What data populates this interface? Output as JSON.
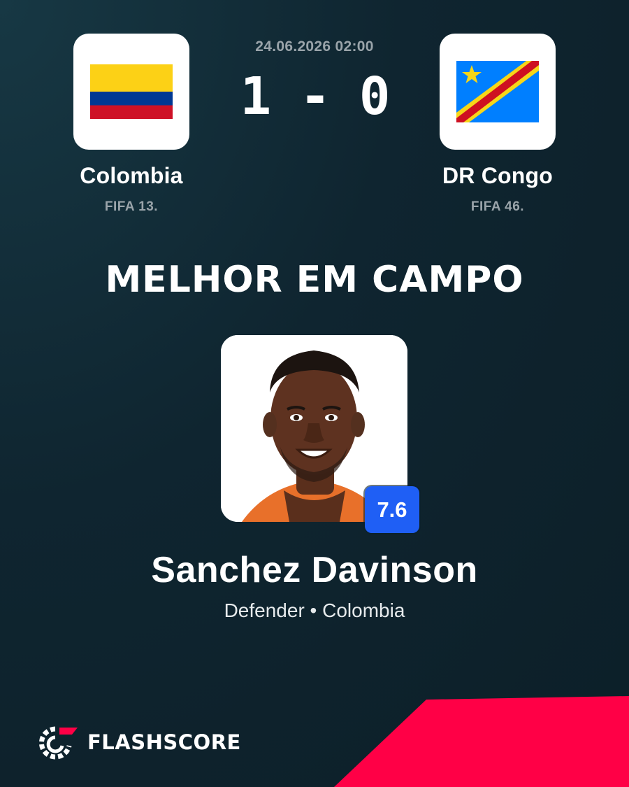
{
  "match": {
    "date": "24.06.2026 02:00",
    "score": "1 - 0"
  },
  "home_team": {
    "name": "Colombia",
    "rank": "FIFA 13.",
    "flag": "colombia-flag",
    "flag_colors": [
      "#fcd116",
      "#003893",
      "#ce1126"
    ]
  },
  "away_team": {
    "name": "DR Congo",
    "rank": "FIFA 46.",
    "flag": "dr-congo-flag",
    "flag_colors": [
      "#007fff",
      "#f7d618",
      "#ce1021"
    ]
  },
  "headline": "MELHOR EM CAMPO",
  "player": {
    "name": "Sanchez Davinson",
    "info": "Defender • Colombia",
    "rating": "7.6"
  },
  "brand": {
    "name": "FLASHSCORE",
    "accent": "#ff0046"
  },
  "colors": {
    "background": "#0f2530",
    "rating_badge": "#1f5ff5",
    "muted_text": "#9aa4aa"
  }
}
